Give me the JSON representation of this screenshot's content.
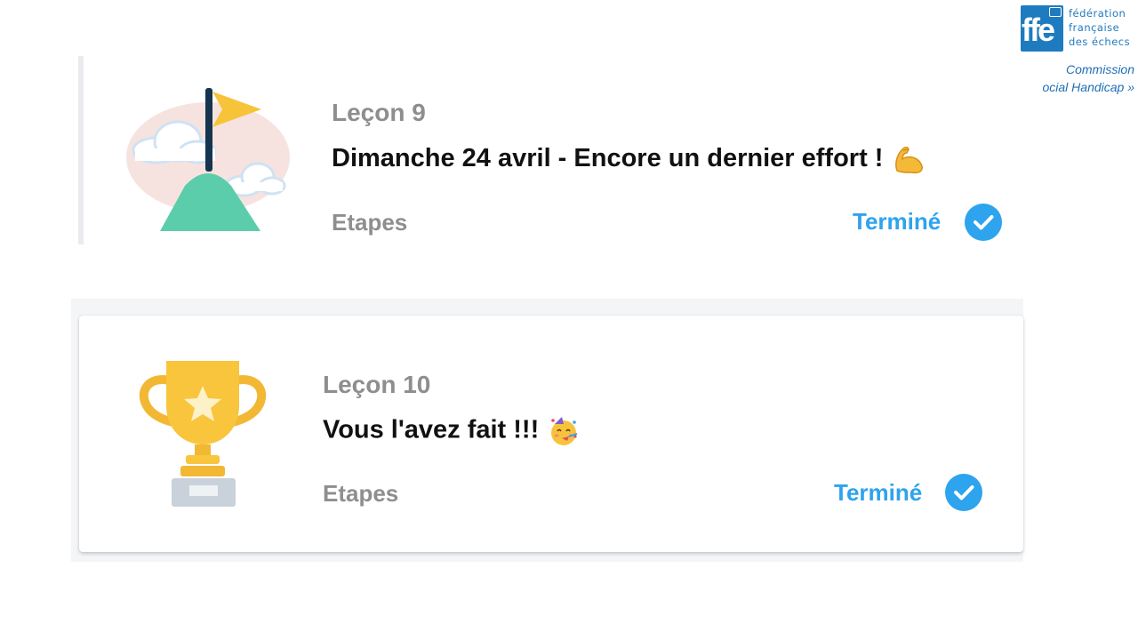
{
  "logo": {
    "mark": "ffe",
    "lines": [
      "fédération",
      "française",
      "des échecs"
    ]
  },
  "commission": {
    "line1": "Commission",
    "line2": "ocial Handicap »"
  },
  "lessons": [
    {
      "label": "Leçon 9",
      "title": "Dimanche 24 avril - Encore un dernier effort !",
      "title_emoji": "flexed-biceps-icon",
      "steps_label": "Etapes",
      "status": "Terminé",
      "illustration": "mountain-flag-icon"
    },
    {
      "label": "Leçon 10",
      "title": "Vous l'avez fait !!!",
      "title_emoji": "partying-face-icon",
      "steps_label": "Etapes",
      "status": "Terminé",
      "illustration": "trophy-icon"
    }
  ],
  "colors": {
    "accent_blue": "#2ea3ee",
    "label_gray": "#8e8e8e",
    "title_black": "#111111",
    "ffe_blue": "#1f7bbf"
  }
}
